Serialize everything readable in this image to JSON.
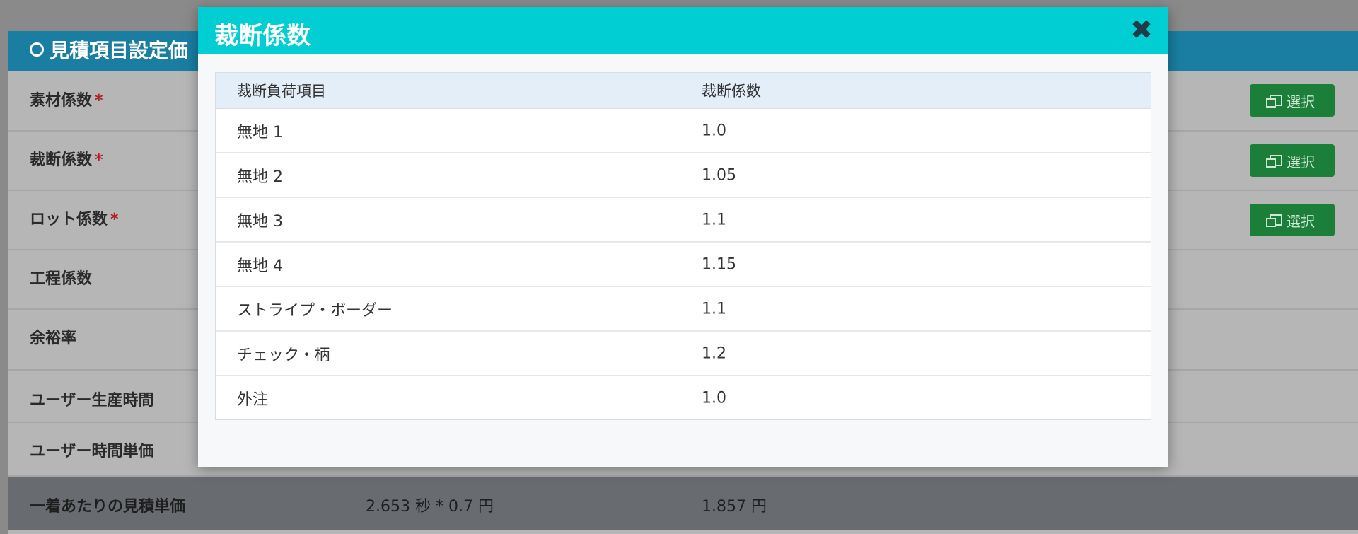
{
  "background": {
    "section_title": "見積項目設定価",
    "rows": [
      {
        "label": "素材係数",
        "required": true,
        "button": "選択"
      },
      {
        "label": "裁断係数",
        "required": true,
        "button": "選択"
      },
      {
        "label": "ロット係数",
        "required": true,
        "button": "選択"
      },
      {
        "label": "工程係数"
      },
      {
        "label": "余裕率"
      },
      {
        "label": "ユーザー生産時間"
      },
      {
        "label": "ユーザー時間単価"
      }
    ],
    "required_mark": "*",
    "total": {
      "label": "一着あたりの見積単価",
      "formula": "2.653 秒 * 0.7 円",
      "value": "1.857 円"
    }
  },
  "modal": {
    "title": "裁断係数",
    "close_icon": "close-icon",
    "columns": [
      "裁断負荷項目",
      "裁断係数"
    ],
    "rows": [
      [
        "無地 1",
        "1.0"
      ],
      [
        "無地 2",
        "1.05"
      ],
      [
        "無地 3",
        "1.1"
      ],
      [
        "無地 4",
        "1.15"
      ],
      [
        "ストライプ・ボーダー",
        "1.1"
      ],
      [
        "チェック・柄",
        "1.2"
      ],
      [
        "外注",
        "1.0"
      ]
    ]
  },
  "colors": {
    "modal_header": "#00ced2",
    "section_header": "#1a7ea2",
    "select_button": "#1b7f3a",
    "required": "#b0201f"
  }
}
